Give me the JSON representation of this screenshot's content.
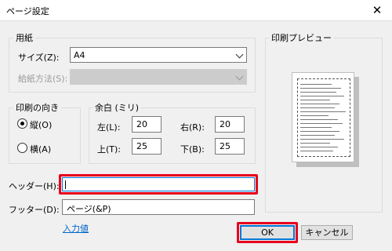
{
  "window": {
    "title": "ページ設定",
    "close_symbol": "✕"
  },
  "paper": {
    "group_label": "用紙",
    "size_label": "サイズ(Z):",
    "size_value": "A4",
    "source_label": "給紙方法(S):",
    "source_value": ""
  },
  "orientation": {
    "group_label": "印刷の向き",
    "portrait_label": "縦(O)",
    "landscape_label": "横(A)",
    "selected": "portrait"
  },
  "margins": {
    "group_label": "余白 (ミリ)",
    "left_label": "左(L):",
    "left_value": "20",
    "right_label": "右(R):",
    "right_value": "20",
    "top_label": "上(T):",
    "top_value": "25",
    "bottom_label": "下(B):",
    "bottom_value": "25"
  },
  "header": {
    "label": "ヘッダー(H):",
    "value": ""
  },
  "footer": {
    "label": "フッター(D):",
    "value": "ページ(&P)"
  },
  "input_value_link": "入力値",
  "preview": {
    "group_label": "印刷プレビュー"
  },
  "buttons": {
    "ok": "OK",
    "cancel": "キャンセル"
  },
  "highlight_color": "#e6001c"
}
